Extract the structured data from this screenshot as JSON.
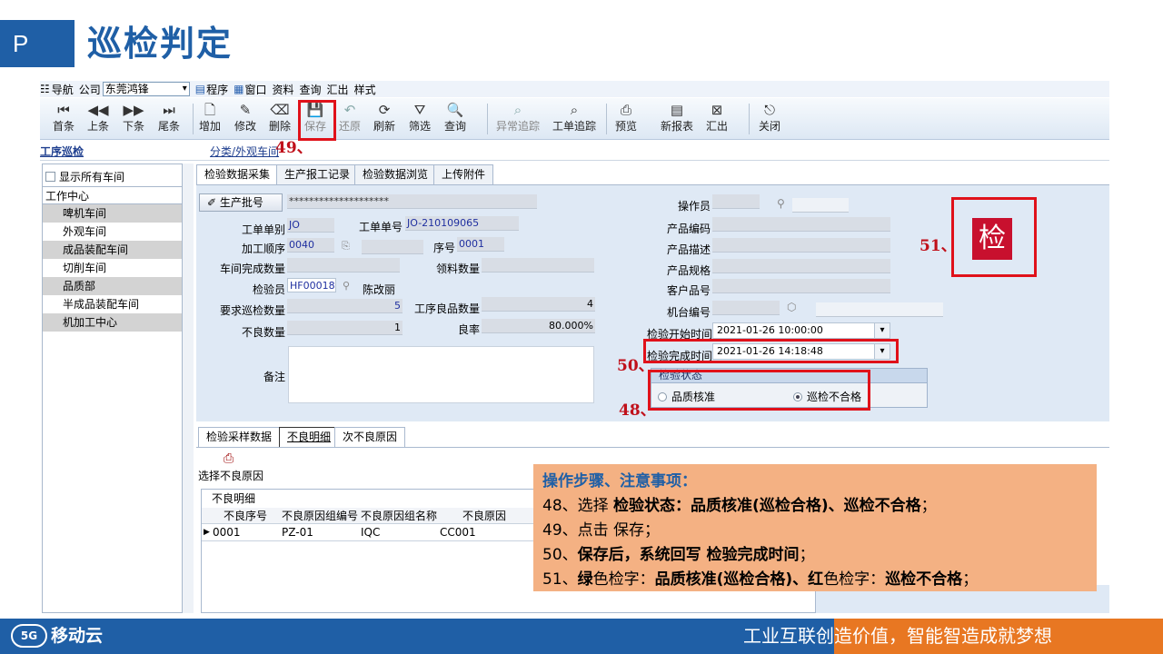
{
  "slide": {
    "marker": "P",
    "title": "巡检判定",
    "footer_slogan": "工业互联创造价值，智能智造成就梦想",
    "logo_mark": "5G",
    "logo_text": "移动云"
  },
  "menubar": {
    "nav": "导航",
    "company_label": "公司",
    "company_value": "东莞鸿锋",
    "program": "程序",
    "window": "窗口",
    "data": "资料",
    "query": "查询",
    "export": "汇出",
    "style": "样式"
  },
  "toolbar": {
    "first": "首条",
    "prev": "上条",
    "next": "下条",
    "last": "尾条",
    "add": "增加",
    "edit": "修改",
    "delete": "删除",
    "save": "保存",
    "restore": "还原",
    "refresh": "刷新",
    "filter": "筛选",
    "query": "查询",
    "exception_trace": "异常追踪",
    "workorder_trace": "工单追踪",
    "preview": "预览",
    "new_report": "新报表",
    "export": "汇出",
    "close": "关闭"
  },
  "breadcrumb": {
    "left": "工序巡检",
    "middle": "分类/外观车间"
  },
  "left_panel": {
    "show_all": "显示所有车间",
    "tree_header": "工作中心",
    "items": [
      "啤机车间",
      "外观车间",
      "成品装配车间",
      "切削车间",
      "品质部",
      "半成品装配车间",
      "机加工中心"
    ]
  },
  "tabs": [
    "检验数据采集",
    "生产报工记录",
    "检验数据浏览",
    "上传附件"
  ],
  "form": {
    "prod_batch_btn": "生产批号",
    "prod_batch_value": "********************",
    "labels": {
      "wo_type": "工单单别",
      "wo_no": "工单单号",
      "proc_seq": "加工顺序",
      "seq": "序号",
      "shop_done_qty": "车间完成数量",
      "pick_qty": "领料数量",
      "inspector": "检验员",
      "req_qty": "要求巡检数量",
      "good_qty": "工序良品数量",
      "bad_qty": "不良数量",
      "yield": "良率",
      "remark": "备注",
      "operator": "操作员",
      "prod_code": "产品编码",
      "prod_desc": "产品描述",
      "prod_spec": "产品规格",
      "cust_part": "客户品号",
      "machine_no": "机台编号",
      "start_time": "检验开始时间",
      "end_time": "检验完成时间"
    },
    "values": {
      "wo_type": "JO",
      "wo_no": "JO-210109065",
      "proc_seq": "0040",
      "seq": "0001",
      "inspector_code": "HF00018",
      "inspector_name": "陈改丽",
      "req_qty": "5",
      "good_qty": "4",
      "bad_qty": "1",
      "yield": "80.000%",
      "start_time": "2021-01-26 10:00:00",
      "end_time": "2021-01-26 14:18:48"
    },
    "status_group": "检验状态",
    "status_options": [
      "品质核准",
      "巡检不合格"
    ],
    "status_selected": "巡检不合格"
  },
  "stamp_char": "检",
  "annotations": {
    "a48": "48、",
    "a49": "49、",
    "a50": "50、",
    "a51": "51、"
  },
  "sub_tabs": [
    "检验采样数据",
    "不良明细",
    "次不良原因"
  ],
  "bad_reason": {
    "select_label": "选择不良原因",
    "grid_title": "不良明细",
    "columns": [
      "不良序号",
      "不良原因组编号",
      "不良原因组名称",
      "不良原因"
    ],
    "rows": [
      [
        "0001",
        "PZ-01",
        "IQC",
        "CC001"
      ]
    ]
  },
  "notes": {
    "heading": "操作步骤、注意事项：",
    "l48a": "48、选择 ",
    "l48b": "检验状态：品质核准(巡检合格)、巡检不合格",
    "l48c": "；",
    "l49": "49、点击 保存；",
    "l50a": "50、",
    "l50b": "保存后，系统回写 检验完成时间",
    "l50c": "；",
    "l51a": "51、",
    "l51b": "绿",
    "l51c": "色检字：",
    "l51d": "品质核准(巡检合格)、红",
    "l51e": "色检字：",
    "l51f": "巡检不合格",
    "l51g": "；"
  }
}
